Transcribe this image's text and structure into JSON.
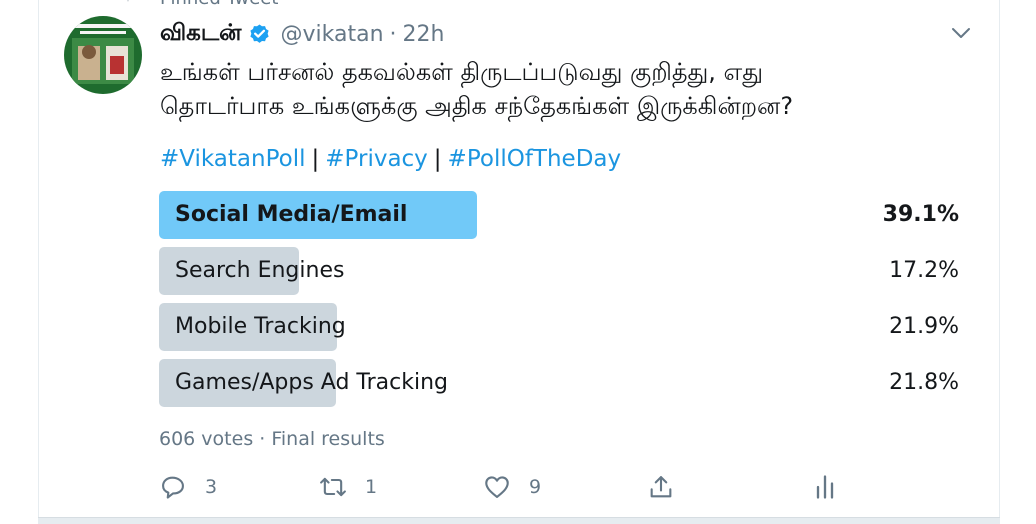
{
  "tweet": {
    "pinned_label": "Pinned Tweet",
    "author_name": "விகடன்",
    "handle": "@vikatan",
    "separator": "·",
    "time": "22h",
    "text_lines": [
      "உங்கள் பர்சனல் தகவல்கள் திருடப்படுவது குறித்து, எது",
      "தொடர்பாக உங்களுக்கு அதிக சந்தேகங்கள் இருக்கின்றன?"
    ],
    "hashtags": [
      "#VikatanPoll",
      "#Privacy",
      "#PollOfTheDay"
    ],
    "hashtag_separator": "|"
  },
  "poll": {
    "options": [
      {
        "label": "Social Media/Email",
        "percent": "39.1%",
        "value": 39.1,
        "winner": true
      },
      {
        "label": "Search Engines",
        "percent": "17.2%",
        "value": 17.2,
        "winner": false
      },
      {
        "label": "Mobile Tracking",
        "percent": "21.9%",
        "value": 21.9,
        "winner": false
      },
      {
        "label": "Games/Apps Ad Tracking",
        "percent": "21.8%",
        "value": 21.8,
        "winner": false
      }
    ],
    "summary": "606 votes · Final results"
  },
  "actions": {
    "reply_count": "3",
    "retweet_count": "1",
    "like_count": "9"
  },
  "colors": {
    "accent": "#1b95e0",
    "winner_bar": "#71c9f8",
    "loser_bar": "#ccd6dd",
    "muted_text": "#657786"
  },
  "icons": [
    "pin-icon",
    "verified-icon",
    "chevron-down-icon",
    "reply-icon",
    "retweet-icon",
    "like-icon",
    "share-icon",
    "analytics-icon"
  ]
}
